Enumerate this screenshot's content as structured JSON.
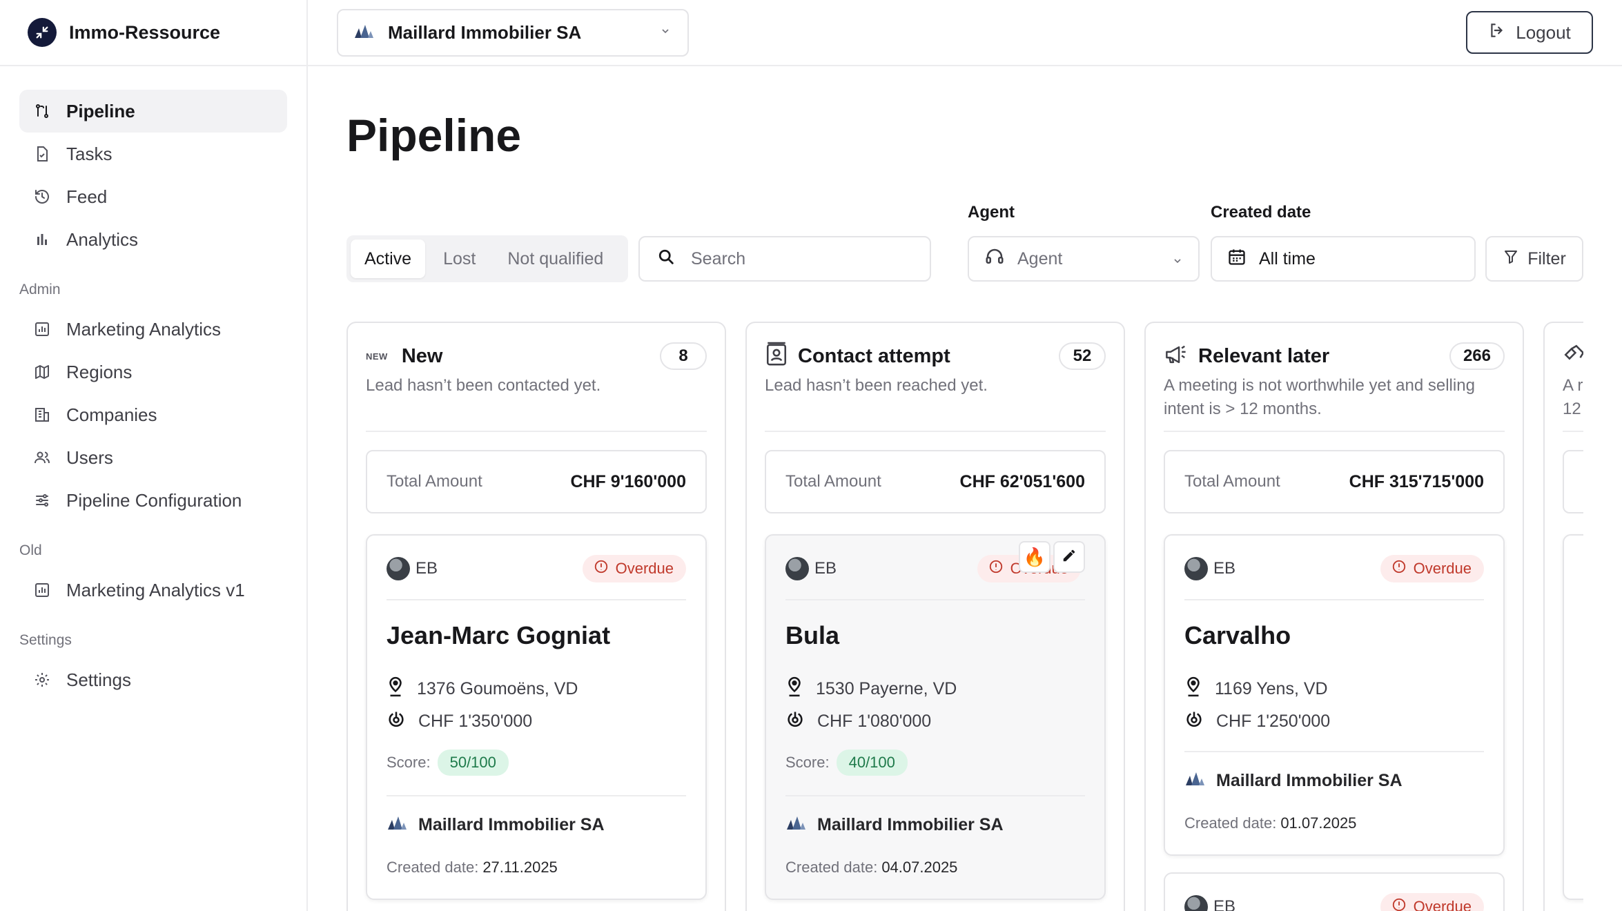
{
  "app": {
    "name": "Immo-Ressource"
  },
  "sidebar": {
    "items": [
      {
        "label": "Pipeline",
        "icon": "pipeline-icon",
        "active": true
      },
      {
        "label": "Tasks",
        "icon": "task-icon"
      },
      {
        "label": "Feed",
        "icon": "history-icon"
      },
      {
        "label": "Analytics",
        "icon": "bar-chart-icon"
      }
    ],
    "admin_label": "Admin",
    "admin_items": [
      {
        "label": "Marketing Analytics",
        "icon": "chart-box-icon"
      },
      {
        "label": "Regions",
        "icon": "map-icon"
      },
      {
        "label": "Companies",
        "icon": "building-icon"
      },
      {
        "label": "Users",
        "icon": "users-icon"
      },
      {
        "label": "Pipeline Configuration",
        "icon": "sliders-icon"
      }
    ],
    "old_label": "Old",
    "old_items": [
      {
        "label": "Marketing Analytics v1",
        "icon": "chart-box-icon"
      }
    ],
    "settings_label": "Settings",
    "settings_items": [
      {
        "label": "Settings",
        "icon": "gear-icon"
      }
    ]
  },
  "topbar": {
    "company": "Maillard Immobilier SA",
    "logout": "Logout"
  },
  "page": {
    "title": "Pipeline",
    "tabs": [
      {
        "label": "Active",
        "active": true
      },
      {
        "label": "Lost"
      },
      {
        "label": "Not qualified"
      }
    ],
    "search_placeholder": "Search",
    "agent_label": "Agent",
    "agent_placeholder": "Agent",
    "created_label": "Created date",
    "created_value": "All time",
    "filter": "Filter"
  },
  "columns": [
    {
      "badge": "NEW",
      "title": "New",
      "count": "8",
      "desc": "Lead hasn’t been contacted yet.",
      "total_label": "Total Amount",
      "total_value": "CHF 9'160'000",
      "card": {
        "initials": "EB",
        "status": "Overdue",
        "name": "Jean-Marc Gogniat",
        "location": "1376 Goumoëns, VD",
        "price": "CHF 1'350'000",
        "score_label": "Score:",
        "score": "50/100",
        "company": "Maillard Immobilier SA",
        "created_label": "Created date:",
        "created": "27.11.2025"
      }
    },
    {
      "title": "Contact attempt",
      "count": "52",
      "desc": "Lead hasn’t been reached yet.",
      "total_label": "Total Amount",
      "total_value": "CHF 62'051'600",
      "card": {
        "initials": "EB",
        "status": "Overdue",
        "name": "Bula",
        "location": "1530 Payerne, VD",
        "price": "CHF 1'080'000",
        "score_label": "Score:",
        "score": "40/100",
        "company": "Maillard Immobilier SA",
        "created_label": "Created date:",
        "created": "04.07.2025"
      }
    },
    {
      "title": "Relevant later",
      "count": "266",
      "desc": "A meeting is not worthwhile yet and selling intent is > 12 months.",
      "total_label": "Total Amount",
      "total_value": "CHF 315'715'000",
      "card": {
        "initials": "EB",
        "status": "Overdue",
        "name": "Carvalho",
        "location": "1169 Yens, VD",
        "price": "CHF 1'250'000",
        "company": "Maillard Immobilier SA",
        "created_label": "Created date:",
        "created": "01.07.2025"
      },
      "card2": {
        "initials": "EB",
        "status": "Overdue"
      }
    },
    {
      "desc_partial": "A r\n12"
    }
  ],
  "colors": {
    "overdue_bg": "#fdecec",
    "overdue_text": "#c0392b",
    "score_bg": "#dcf5e7",
    "score_text": "#1e7a4a",
    "brand_dark": "#141a3a"
  }
}
